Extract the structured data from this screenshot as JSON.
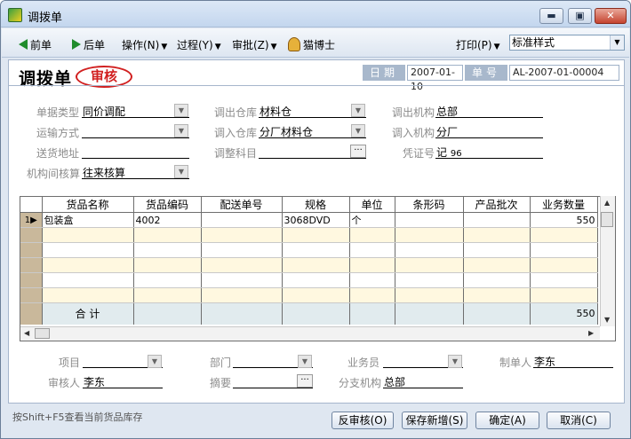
{
  "window": {
    "title": "调拨单",
    "min_label": "▬",
    "max_label": "▣",
    "close_label": "✕"
  },
  "toolbar": {
    "prev": "前单",
    "next": "后单",
    "operate": "操作(N)",
    "process": "过程(Y)",
    "approve": "审批(Z)",
    "helper": "猫博士",
    "print": "打印(P)",
    "style_value": "标准样式"
  },
  "form": {
    "title": "调拨单",
    "status_stamp": "审核",
    "date_label": "日期",
    "date_value": "2007-01-10",
    "no_label": "单号",
    "no_value": "AL-2007-01-00004",
    "fields": {
      "doc_type_label": "单据类型",
      "doc_type_value": "同价调配",
      "transport_label": "运输方式",
      "transport_value": "",
      "ship_addr_label": "送货地址",
      "ship_addr_value": "",
      "inter_org_label": "机构间核算",
      "inter_org_value": "往来核算",
      "out_wh_label": "调出仓库",
      "out_wh_value": "材料仓",
      "in_wh_label": "调入仓库",
      "in_wh_value": "分厂材料仓",
      "adjust_label": "调整科目",
      "adjust_value": "",
      "out_org_label": "调出机构",
      "out_org_value": "总部",
      "in_org_label": "调入机构",
      "in_org_value": "分厂",
      "voucher_label": "凭证号",
      "voucher_prefix": "记",
      "voucher_value": "96"
    }
  },
  "grid": {
    "columns": [
      "货品名称",
      "货品编码",
      "配送单号",
      "规格",
      "单位",
      "条形码",
      "产品批次",
      "业务数量"
    ],
    "rows": [
      {
        "no": "1",
        "cells": [
          "包装盒",
          "4002",
          "",
          "3068DVD",
          "个",
          "",
          "",
          "550"
        ]
      }
    ],
    "total_label": "合  计",
    "total_qty": "550"
  },
  "footer": {
    "item_label": "项目",
    "item_value": "",
    "dept_label": "部门",
    "dept_value": "",
    "sales_label": "业务员",
    "sales_value": "",
    "maker_label": "制单人",
    "maker_value": "李东",
    "auditor_label": "审核人",
    "auditor_value": "李东",
    "summary_label": "摘要",
    "summary_value": "",
    "branch_label": "分支机构",
    "branch_value": "总部"
  },
  "status": {
    "hint": "按Shift+F5查看当前货品库存"
  },
  "buttons": {
    "unaudit": "反审核(O)",
    "save_new": "保存新增(S)",
    "ok": "确定(A)",
    "cancel": "取消(C)"
  },
  "colors": {
    "stamp": "#d12020",
    "arrow": "#1f8c2c",
    "row_header": "#c9b89b",
    "total_row": "#e1ebee"
  }
}
